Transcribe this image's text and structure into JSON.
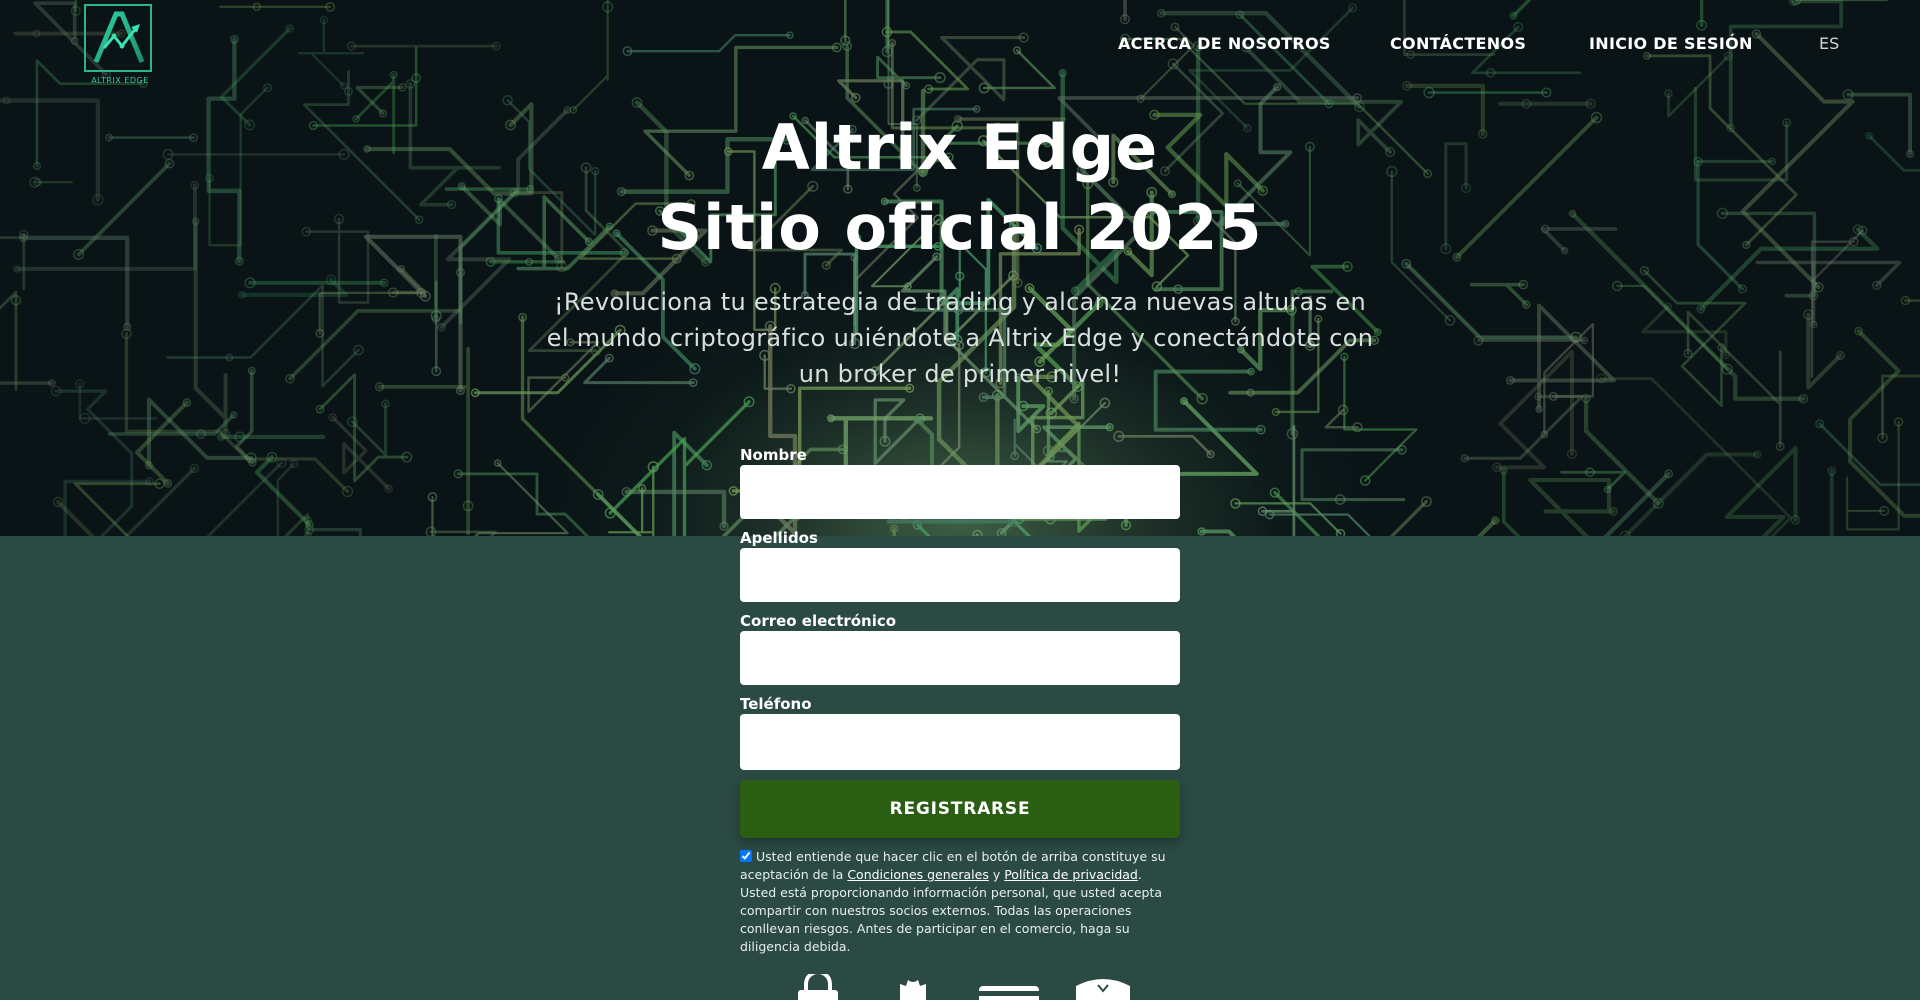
{
  "brand": {
    "logo_text": "ALTRIX EDGE",
    "accent_color": "#2bb58a"
  },
  "nav": {
    "about": "ACERCA DE NOSOTROS",
    "contact": "CONTÁCTENOS",
    "login": "INICIO DE SESIÓN",
    "language": "ES"
  },
  "hero": {
    "title_line1": "Altrix Edge",
    "title_line2": "Sitio oficial 2025",
    "subtitle": "¡Revoluciona tu estrategia de trading y alcanza nuevas alturas en el mundo criptográfico uniéndote a Altrix Edge y conectándote con un broker de primer nivel!"
  },
  "form": {
    "first_name_label": "Nombre",
    "first_name_value": "",
    "last_name_label": "Apellidos",
    "last_name_value": "",
    "email_label": "Correo electrónico",
    "email_value": "",
    "phone_label": "Teléfono",
    "phone_value": "",
    "submit_label": "REGISTRARSE",
    "button_color": "#2a5e12",
    "consent_checked": true,
    "consent_part1": "Usted entiende que hacer clic en el botón de arriba constituye su aceptación de la",
    "terms_link": "Condiciones generales",
    "consent_and": "y",
    "privacy_link": "Política de privacidad",
    "consent_part2": ". Usted está proporcionando información personal, que usted acepta compartir con nuestros socios externos. Todas las operaciones conllevan riesgos. Antes de participar en el comercio, haga su diligencia debida."
  },
  "trust_icons": [
    "lock-icon",
    "shirt-icon",
    "card-icon",
    "shield-icon"
  ],
  "colors": {
    "lower_background": "#2b4a44",
    "hero_dark": "#0a1417"
  }
}
